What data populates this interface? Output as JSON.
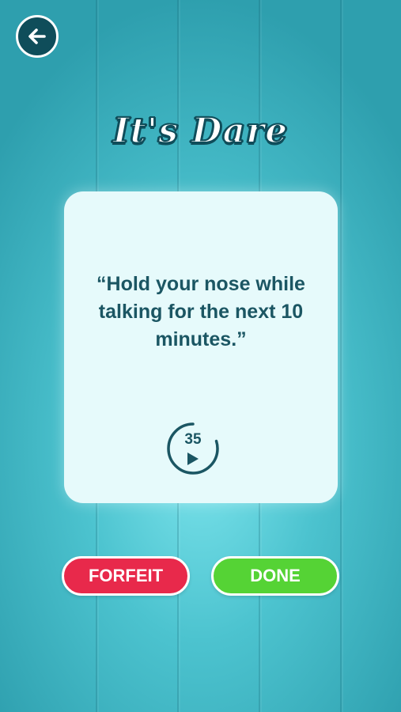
{
  "screen": {
    "title": "It's Dare"
  },
  "card": {
    "dare_text": "“Hold your nose while talking for the next 10 minutes.”",
    "timer": {
      "value": "35",
      "progress_fraction": 0.8
    }
  },
  "buttons": {
    "forfeit_label": "FORFEIT",
    "done_label": "DONE"
  },
  "icons": {
    "back": "arrow-left-icon",
    "play": "play-icon"
  },
  "colors": {
    "background": "#4cc3cf",
    "dark_teal": "#0f4d5a",
    "text_teal": "#1b5663",
    "card": "#e6fafb",
    "forfeit": "#e8294b",
    "done": "#55d335"
  }
}
